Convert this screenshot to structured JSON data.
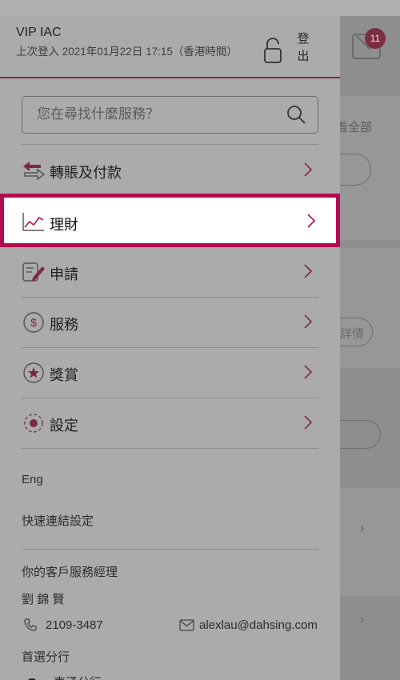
{
  "header": {
    "title": "VIP IAC",
    "last_login": "上次登入 2021年01月22日 17:15（香港時間）",
    "logout_label": "登\n出"
  },
  "search": {
    "placeholder": "您在尋找什麼服務？"
  },
  "menu": [
    {
      "label": "轉賬及付款",
      "icon": "transfer-icon"
    },
    {
      "label": "理財",
      "icon": "chart-line-icon",
      "highlighted": true
    },
    {
      "label": "申請",
      "icon": "application-form-icon"
    },
    {
      "label": "服務",
      "icon": "dollar-circle-icon"
    },
    {
      "label": "獎賞",
      "icon": "star-circle-icon"
    },
    {
      "label": "設定",
      "icon": "gear-icon"
    }
  ],
  "links": {
    "language": "Eng",
    "quick_link_settings": "快速連結設定"
  },
  "manager": {
    "heading": "你的客戶服務經理",
    "name": "劉 錦 賢",
    "phone": "2109-3487",
    "email": "alexlau@dahsing.com"
  },
  "branch": {
    "heading": "首選分行",
    "name": "東涌分行"
  },
  "background": {
    "badge_count": "11",
    "view_all": "看全部",
    "details": "詳情"
  },
  "colors": {
    "accent": "#b30b50",
    "dimmed_header_rule": "#7b2a40"
  }
}
